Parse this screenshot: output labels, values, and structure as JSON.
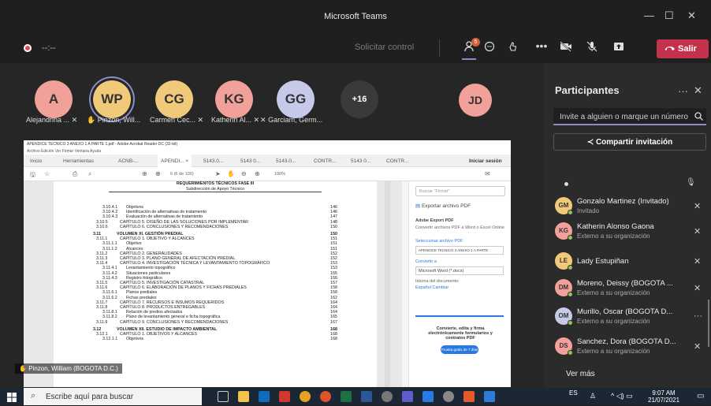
{
  "window": {
    "title": "Microsoft Teams",
    "minimize": "—",
    "maximize": "☐",
    "close": "✕"
  },
  "call": {
    "timer": "--:--",
    "request_control": "Solicitar control",
    "leave": "Salir",
    "participants_badge": "5"
  },
  "stage": {
    "avatars": [
      {
        "initials": "A",
        "label": "Alejandrina ...",
        "color": "#f1a09a"
      },
      {
        "initials": "WP",
        "label": "Pinzon, Will...",
        "color": "#f0c97a"
      },
      {
        "initials": "CG",
        "label": "Carmen Cec...",
        "color": "#f0c97a"
      },
      {
        "initials": "KG",
        "label": "Katherin Al...",
        "color": "#f1a09a"
      },
      {
        "initials": "GG",
        "label": "Garciam, Germ...",
        "color": "#c6c9e8"
      },
      {
        "initials": "+16",
        "label": "",
        "color": "#3a3a3a"
      },
      {
        "initials": "JD",
        "label": "",
        "color": "#f1a09a"
      }
    ],
    "presenter_label": "Pinzon, William (BOGOTA D.C.)"
  },
  "shared": {
    "acrobat_title": "APENDICE TECNICO 3 ANEXO 1 A PARTE 1.pdf - Adobe Acrobat Reader DC (32-bit)",
    "menu": "Archivo  Edición  Ver  Firmar  Ventana  Ayuda",
    "tabs": [
      "Inicio",
      "Herramientas",
      "ACNB-...",
      "APENDI... ×",
      "5143.0...",
      "5143 0...",
      "5143.0...",
      "CONTR...",
      "5143 0...",
      "CONTR..."
    ],
    "sign_in": "Iniciar sesión",
    "page_info": "6 (6 de 100)",
    "zoom": "100%",
    "doc_header": "REQUERIMIENTOS TÉCNICOS FASE III",
    "doc_subheader": "Subdirección de Apoyo Técnico",
    "toc": [
      {
        "num": "3.10.4.1",
        "text": "Objetivos",
        "page": "146",
        "bold": false
      },
      {
        "num": "3.10.4.2",
        "text": "Identificación de alternativas de tratamiento",
        "page": "146",
        "bold": false
      },
      {
        "num": "3.10.4.3",
        "text": "Evaluación de alternativas de tratamiento",
        "page": "147",
        "bold": false
      },
      {
        "num": "3.10.5",
        "text": "CAPÍTULO 5. DISEÑO DE LAS SOLUCIONES POR IMPLEMENTAR",
        "page": "148",
        "bold": false
      },
      {
        "num": "3.10.6",
        "text": "CAPÍTULO 6. CONCLUSIONES Y RECOMENDACIONES",
        "page": "150",
        "bold": false
      },
      {
        "num": "3.11",
        "text": "VOLUMEN XI. GESTIÓN PREDIAL",
        "page": "150",
        "bold": true
      },
      {
        "num": "3.11.1",
        "text": "CAPÍTULO 1. OBJETIVO Y ALCANCES",
        "page": "151",
        "bold": false
      },
      {
        "num": "3.11.1.1",
        "text": "Objetivo",
        "page": "151",
        "bold": false
      },
      {
        "num": "3.11.1.2",
        "text": "Alcances",
        "page": "151",
        "bold": false
      },
      {
        "num": "3.11.2",
        "text": "CAPÍTULO 2. GENERALIDADES",
        "page": "152",
        "bold": false
      },
      {
        "num": "3.11.3",
        "text": "CAPÍTULO 3. PLANO GENERAL DE AFECTACIÓN PREDIAL",
        "page": "152",
        "bold": false
      },
      {
        "num": "3.11.4",
        "text": "CAPÍTULO 4. INVESTIGACIÓN TÉCNICA Y LEVANTAMIENTO TOPOGRÁFICO",
        "page": "153",
        "bold": false
      },
      {
        "num": "3.11.4.1",
        "text": "Levantamiento topográfico",
        "page": "153",
        "bold": false
      },
      {
        "num": "3.11.4.2",
        "text": "Situaciones particulares",
        "page": "155",
        "bold": false
      },
      {
        "num": "3.11.4.3",
        "text": "Registro fotográfico",
        "page": "156",
        "bold": false
      },
      {
        "num": "3.11.5",
        "text": "CAPÍTULO 5. INVESTIGACIÓN CATASTRAL",
        "page": "157",
        "bold": false
      },
      {
        "num": "3.11.6",
        "text": "CAPÍTULO 6. ELABORACIÓN DE PLANOS Y FICHAS PREDIALES",
        "page": "158",
        "bold": false
      },
      {
        "num": "3.11.6.1",
        "text": "Planos prediales",
        "page": "158",
        "bold": false
      },
      {
        "num": "3.11.6.2",
        "text": "Fichas prediales",
        "page": "162",
        "bold": false
      },
      {
        "num": "3.11.7",
        "text": "CAPÍTULO 7. RECURSOS E INSUMOS REQUERIDOS",
        "page": "164",
        "bold": false
      },
      {
        "num": "3.11.8",
        "text": "CAPÍTULO 8. PRODUCTOS ENTREGABLES",
        "page": "164",
        "bold": false
      },
      {
        "num": "3.11.8.1",
        "text": "Relación de predios afectados",
        "page": "164",
        "bold": false
      },
      {
        "num": "3.11.8.2",
        "text": "Plano de levantamiento general e ficha topográfica",
        "page": "165",
        "bold": false
      },
      {
        "num": "3.11.9",
        "text": "CAPÍTULO 9. CONCLUSIONES Y RECOMENDACIONES",
        "page": "167",
        "bold": false
      },
      {
        "num": "3.12",
        "text": "VOLUMEN XII. ESTUDIO DE IMPACTO AMBIENTAL",
        "page": "168",
        "bold": true
      },
      {
        "num": "3.12.1",
        "text": "CAPÍTULO 1. OBJETIVOS Y ALCANCES",
        "page": "168",
        "bold": false
      },
      {
        "num": "3.12.1.1",
        "text": "Objetivos",
        "page": "168",
        "bold": false
      }
    ],
    "panel": {
      "search_placeholder": "Buscar \"Firmar\"",
      "export_title": "Exportar archivo PDF",
      "export_heading": "Adobe Export PDF",
      "export_desc": "Convertir archivos PDF a Word o Excel Online",
      "select_label": "Seleccionar archivo PDF",
      "file": "APENDICE TECNICO 3 ANEXO 1 A PARTE",
      "convert_label": "Convertir a",
      "convert_value": "Microsoft Word (*.docx)",
      "lang_label": "Idioma del documento:",
      "lang_value": "Español  Cambiar",
      "promo": "Convierte, edita y firma electrónicamente formularios y contratos PDF",
      "trial": "Prueba gratis de 7 días"
    }
  },
  "panel": {
    "title": "Participantes",
    "invite_placeholder": "Invite a alguien o marque un número",
    "share_invite": "Compartir invitación",
    "see_more": "Ver más",
    "participants": [
      {
        "initials": "GM",
        "name": "Gonzalo Martinez (Invitado)",
        "sub": "Invitado",
        "color": "#f0c97a"
      },
      {
        "initials": "KG",
        "name": "Katherin Alonso Gaona",
        "sub": "Externo a su organización",
        "color": "#f1a09a"
      },
      {
        "initials": "LE",
        "name": "Lady Estupiñan",
        "sub": "",
        "color": "#f0c97a"
      },
      {
        "initials": "DM",
        "name": "Moreno, Deissy (BOGOTA ...",
        "sub": "Externo a su organización",
        "color": "#f1a09a"
      },
      {
        "initials": "OM",
        "name": "Murillo, Oscar (BOGOTA D...",
        "sub": "Externo a su organización",
        "color": "#c6c9e8"
      },
      {
        "initials": "DS",
        "name": "Sanchez, Dora (BOGOTA D...",
        "sub": "Externo a su organización",
        "color": "#f1a09a"
      }
    ]
  },
  "taskbar": {
    "search": "Escribe aquí para buscar",
    "lang": "ES",
    "time": "9:07 AM",
    "date": "21/07/2021"
  }
}
